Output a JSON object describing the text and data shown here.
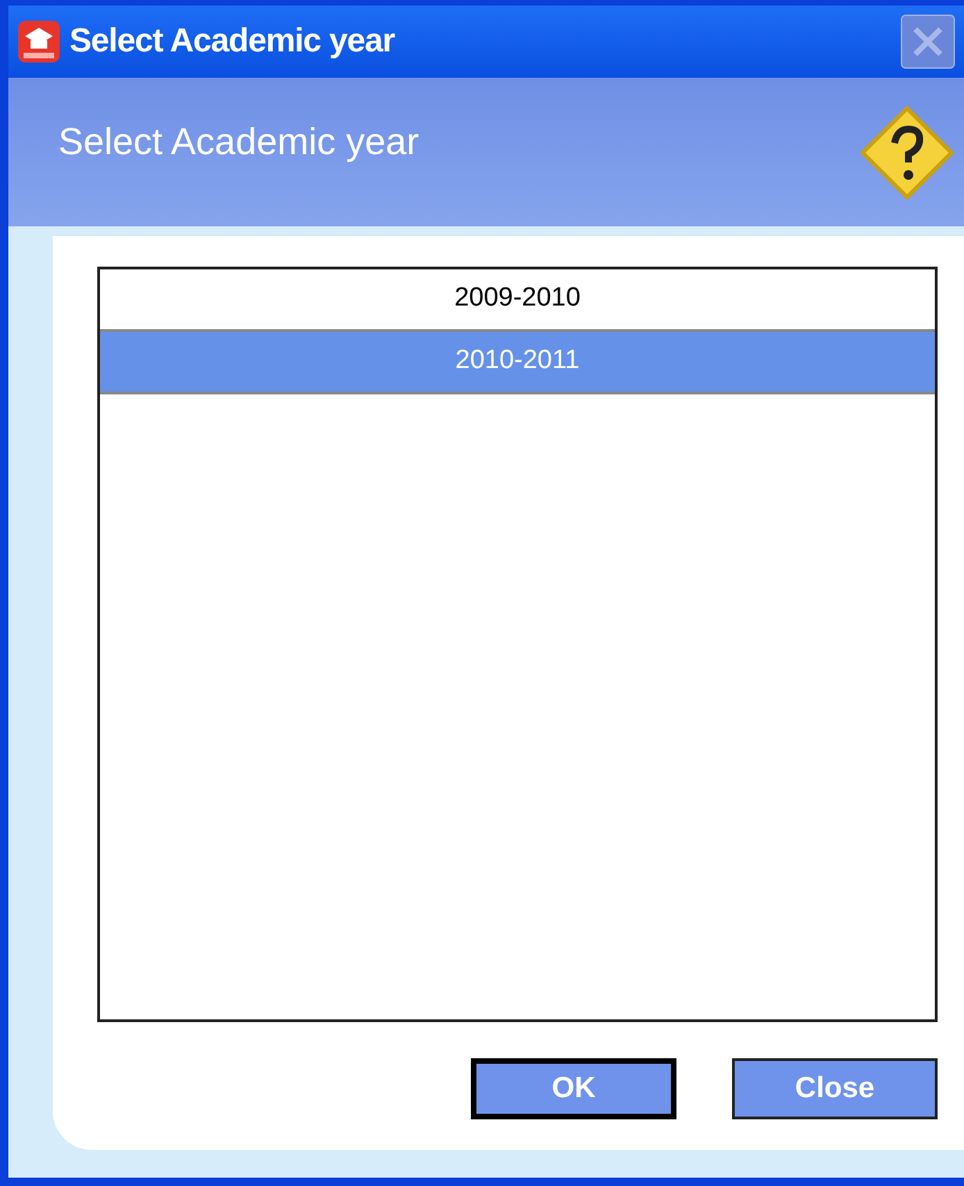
{
  "window": {
    "title": "Select Academic year"
  },
  "header": {
    "title": "Select Academic year"
  },
  "list": {
    "items": [
      {
        "label": "2009-2010",
        "selected": false
      },
      {
        "label": "2010-2011",
        "selected": true
      }
    ]
  },
  "buttons": [
    {
      "label": "OK",
      "default": true
    },
    {
      "label": "Close",
      "default": false
    }
  ]
}
